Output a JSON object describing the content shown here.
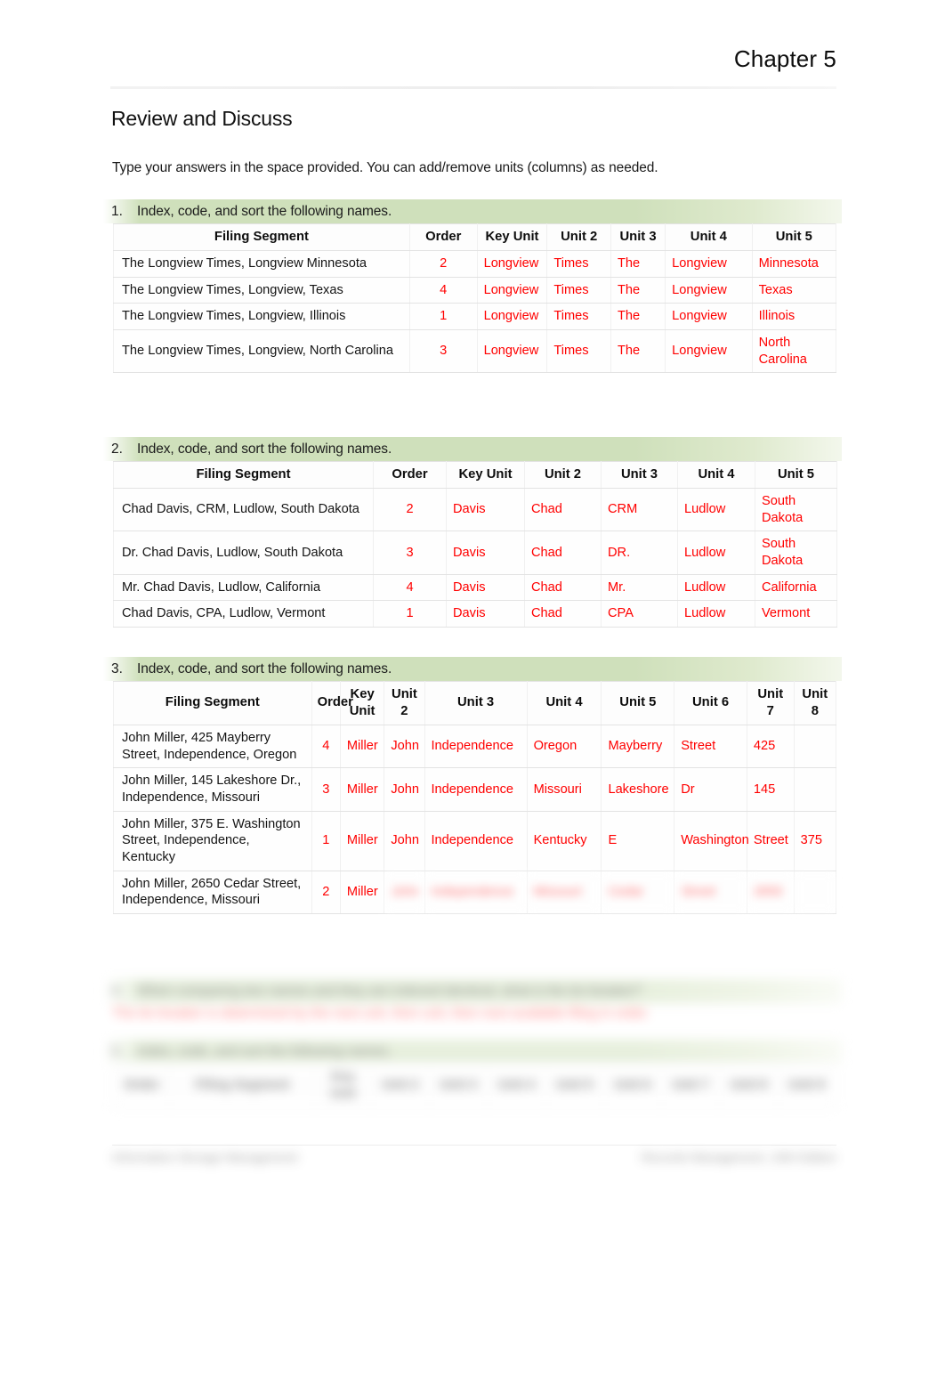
{
  "header": {
    "chapter": "Chapter 5"
  },
  "page": {
    "section_title": "Review and Discuss",
    "intro": "Type your answers in the space provided. You can add/remove units (columns) as needed."
  },
  "colors": {
    "banner_green": "#cfe0bb",
    "answer_red": "#ff0000",
    "text_black": "#111111",
    "grid_gray": "#e3e3e3"
  },
  "questions": [
    {
      "number": "1.",
      "prompt": "Index, code, and sort the following names.",
      "table": {
        "headers": [
          "Filing Segment",
          "Order",
          "Key Unit",
          "Unit 2",
          "Unit 3",
          "Unit 4",
          "Unit 5"
        ],
        "rows": [
          {
            "segment": "The Longview Times, Longview Minnesota",
            "order": "2",
            "units": [
              "Longview",
              "Times",
              "The",
              "Longview",
              "Minnesota"
            ]
          },
          {
            "segment": "The Longview Times, Longview, Texas",
            "order": "4",
            "units": [
              "Longview",
              "Times",
              "The",
              "Longview",
              "Texas"
            ]
          },
          {
            "segment": "The Longview Times, Longview, Illinois",
            "order": "1",
            "units": [
              "Longview",
              "Times",
              "The",
              "Longview",
              "Illinois"
            ]
          },
          {
            "segment": "The Longview Times, Longview, North Carolina",
            "order": "3",
            "units": [
              "Longview",
              "Times",
              "The",
              "Longview",
              "North Carolina"
            ]
          }
        ]
      }
    },
    {
      "number": "2.",
      "prompt": "Index, code, and sort the following names.",
      "table": {
        "headers": [
          "Filing Segment",
          "Order",
          "Key Unit",
          "Unit 2",
          "Unit 3",
          "Unit 4",
          "Unit 5"
        ],
        "rows": [
          {
            "segment": "Chad Davis, CRM, Ludlow, South Dakota",
            "order": "2",
            "units": [
              "Davis",
              "Chad",
              "CRM",
              "Ludlow",
              "South Dakota"
            ]
          },
          {
            "segment": "Dr. Chad Davis, Ludlow, South Dakota",
            "order": "3",
            "units": [
              "Davis",
              "Chad",
              "DR.",
              "Ludlow",
              "South Dakota"
            ]
          },
          {
            "segment": "Mr. Chad Davis, Ludlow, California",
            "order": "4",
            "units": [
              "Davis",
              "Chad",
              "Mr.",
              "Ludlow",
              "California"
            ]
          },
          {
            "segment": "Chad Davis, CPA, Ludlow, Vermont",
            "order": "1",
            "units": [
              "Davis",
              "Chad",
              "CPA",
              "Ludlow",
              "Vermont"
            ]
          }
        ]
      }
    },
    {
      "number": "3.",
      "prompt": "Index, code, and sort the following names.",
      "table": {
        "headers": [
          "Filing Segment",
          "Order",
          "Key Unit",
          "Unit 2",
          "Unit 3",
          "Unit 4",
          "Unit 5",
          "Unit 6",
          "Unit 7",
          "Unit 8"
        ],
        "rows": [
          {
            "segment": "John Miller, 425 Mayberry Street, Independence, Oregon",
            "order": "4",
            "units": [
              "Miller",
              "John",
              "Independence",
              "Oregon",
              "Mayberry",
              "Street",
              "425",
              ""
            ],
            "redacted": false
          },
          {
            "segment": "John Miller, 145 Lakeshore Dr., Independence, Missouri",
            "order": "3",
            "units": [
              "Miller",
              "John",
              "Independence",
              "Missouri",
              "Lakeshore",
              "Dr",
              "145",
              ""
            ],
            "redacted": false
          },
          {
            "segment": "John Miller, 375 E. Washington Street, Independence, Kentucky",
            "order": "1",
            "units": [
              "Miller",
              "John",
              "Independence",
              "Kentucky",
              "E",
              "Washington",
              "Street",
              "375"
            ],
            "redacted": false
          },
          {
            "segment": "John Miller, 2650 Cedar Street, Independence, Missouri",
            "order": "2",
            "units": [
              "Miller",
              "John",
              "Independence",
              "Missouri",
              "Cedar",
              "Street",
              "2650",
              ""
            ],
            "redacted": true
          }
        ]
      }
    },
    {
      "number": "4.",
      "prompt": "When comparing two names and they are indexed identical, what is the tie breaker?",
      "answer": "The tie breaker is determined by the next unit, then unit, then next available filing in order.",
      "redacted": true
    },
    {
      "number": "5.",
      "prompt": "Index, code, and sort the following names.",
      "redacted": true,
      "table": {
        "headers": [
          "Order",
          "Filing Segment",
          "Key Unit",
          "Unit 2",
          "Unit 3",
          "Unit 4",
          "Unit 5",
          "Unit 6",
          "Unit 7",
          "Unit 8",
          "Unit 9"
        ]
      }
    }
  ],
  "footer": {
    "left": "Information Storage Management",
    "right": "Records Management, 10th Edition",
    "redacted": true
  }
}
